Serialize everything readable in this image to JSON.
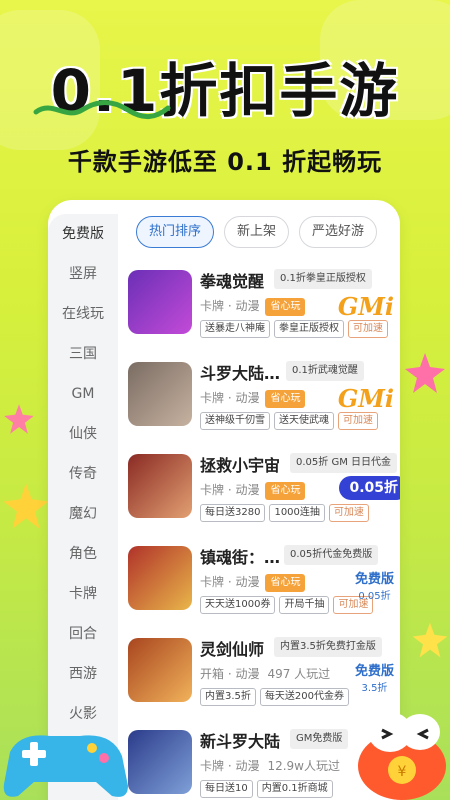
{
  "banner": {
    "headline": "0.1折扣手游",
    "subline": "千款手游低至 0.1 折起畅玩"
  },
  "sidebar": {
    "items": [
      "免费版",
      "竖屏",
      "在线玩",
      "三国",
      "GM",
      "仙侠",
      "传奇",
      "魔幻",
      "角色",
      "卡牌",
      "回合",
      "西游",
      "火影"
    ]
  },
  "tabs": [
    {
      "label": "热门排序",
      "active": true
    },
    {
      "label": "新上架",
      "active": false
    },
    {
      "label": "严选好游",
      "active": false
    }
  ],
  "games": [
    {
      "title": "拳魂觉醒",
      "promo": "0.1折拳皇正版授权",
      "meta": "卡牌 · 动漫",
      "tag": "省心玩",
      "extra": "",
      "chips": [
        "送暴走八神庵",
        "拳皇正版授权",
        "可加速"
      ],
      "badge_type": "gm",
      "badge": "GMi",
      "thumb_colors": [
        "#6b2fb6",
        "#c34bd8"
      ]
    },
    {
      "title": "斗罗大陆…",
      "promo": "0.1折武魂觉醒",
      "meta": "卡牌 · 动漫",
      "tag": "省心玩",
      "extra": "",
      "chips": [
        "送神级千仞雪",
        "送天使武魂",
        "可加速"
      ],
      "badge_type": "gm",
      "badge": "GMi",
      "thumb_colors": [
        "#7a6c63",
        "#c7b2a0"
      ]
    },
    {
      "title": "拯救小宇宙",
      "promo": "0.05折 GM 日日代金",
      "meta": "卡牌 · 动漫",
      "tag": "省心玩",
      "extra": "",
      "chips": [
        "每日送3280",
        "1000连抽",
        "可加速"
      ],
      "badge_type": "disc",
      "badge": "0.05折",
      "thumb_colors": [
        "#8a2a24",
        "#e2a072"
      ]
    },
    {
      "title": "镇魂街：…",
      "promo": "0.05折代金免费版",
      "meta": "卡牌 · 动漫",
      "tag": "省心玩",
      "extra": "",
      "chips": [
        "天天送1000券",
        "开局千抽",
        "可加速"
      ],
      "badge_type": "free",
      "badge": "免费版",
      "badge_sub": "0.05折",
      "thumb_colors": [
        "#b0322a",
        "#e9b64a"
      ]
    },
    {
      "title": "灵剑仙师",
      "promo": "内置3.5折免费打金版",
      "meta": "开箱 · 动漫",
      "tag": "",
      "extra": "497 人玩过",
      "chips": [
        "内置3.5折",
        "每天送200代金券"
      ],
      "badge_type": "free",
      "badge": "免费版",
      "badge_sub": "3.5折",
      "thumb_colors": [
        "#a8451f",
        "#f1b25a"
      ]
    },
    {
      "title": "新斗罗大陆",
      "promo": "GM免费版",
      "meta": "卡牌 · 动漫",
      "tag": "",
      "extra": "12.9w人玩过",
      "chips": [
        "每日送10",
        "内置0.1折商城"
      ],
      "badge_type": "none",
      "badge": "",
      "thumb_colors": [
        "#2b3b8a",
        "#7fa0d8"
      ]
    }
  ],
  "colors": {
    "accent_blue": "#2f6fca",
    "tag_orange": "#f6a23a",
    "gm_orange": "#f3a11b",
    "discount_blue": "#3342d4"
  }
}
